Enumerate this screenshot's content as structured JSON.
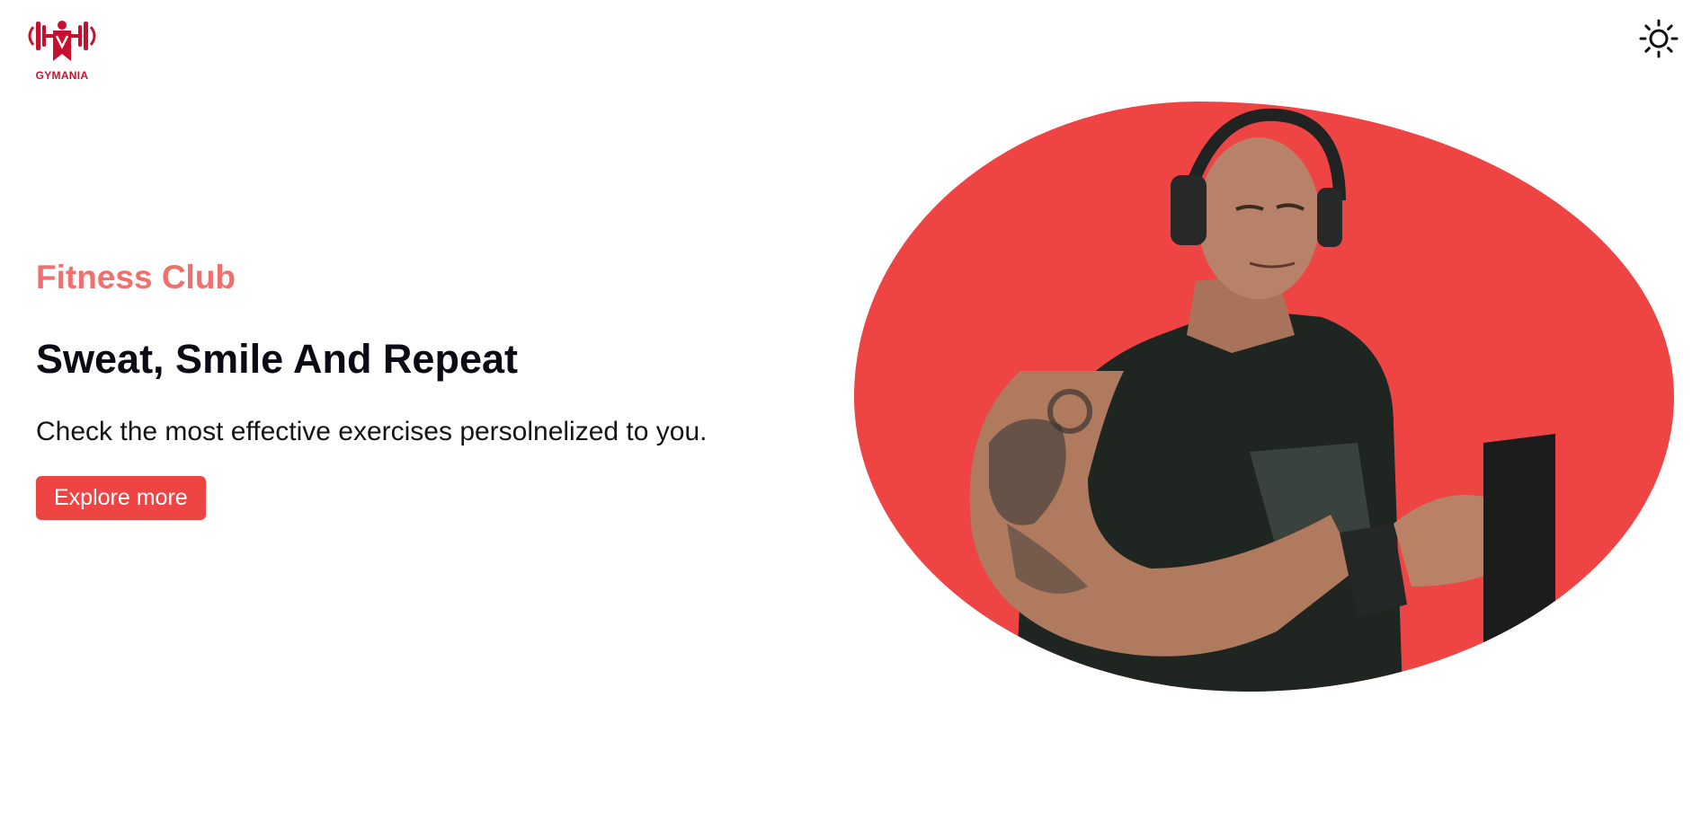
{
  "brand": {
    "name": "GYMANIA",
    "color": "#c8102e"
  },
  "header": {
    "theme_toggle_icon": "sun-icon"
  },
  "hero": {
    "eyebrow": "Fitness Club",
    "headline": "Sweat, Smile And Repeat",
    "subtext": "Check the most effective exercises persolnelized to you.",
    "cta_label": "Explore more",
    "accent_color": "#ef4444",
    "eyebrow_color": "#f0706e",
    "image_icon": "athlete-photo"
  }
}
